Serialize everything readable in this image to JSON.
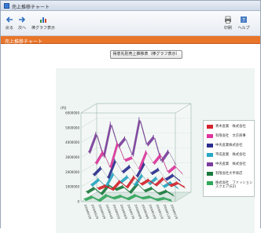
{
  "window": {
    "title": "売上推移チャート"
  },
  "toolbar": {
    "items": [
      {
        "label": "戻る",
        "icon": "back-arrow-icon"
      },
      {
        "label": "次へ",
        "icon": "forward-arrow-icon"
      },
      {
        "label": "棒グラフ表示",
        "icon": "bar-chart-icon"
      },
      {
        "label": "印刷",
        "icon": "printer-icon"
      },
      {
        "label": "ヘルプ",
        "icon": "help-icon"
      }
    ]
  },
  "tab": {
    "title": "売上推移チャート"
  },
  "report_button": {
    "label": "得意先別売上推移表（棒グラフ表示）"
  },
  "chart": {
    "ylabel": "(円)",
    "ytick_labels": [
      "6000000",
      "5000000",
      "4000000",
      "3000000",
      "2000000",
      "1000000",
      "0"
    ],
    "xtick_labels": [
      "2008年01月",
      "2008年02月",
      "2008年03月",
      "2008年04月",
      "2008年05月",
      "2008年06月",
      "2008年07月",
      "2008年08月",
      "2008年09月",
      "2008年10月",
      "2008年11月",
      "2008年12月",
      "2009年01月"
    ]
  },
  "chart_data": {
    "type": "line",
    "view": "3d",
    "ylim": [
      0,
      6000000
    ],
    "x": [
      "2008年01月",
      "2008年02月",
      "2008年03月",
      "2008年04月",
      "2008年05月",
      "2008年06月",
      "2008年07月",
      "2008年08月",
      "2008年09月",
      "2008年10月",
      "2008年11月",
      "2008年12月",
      "2009年01月"
    ],
    "series": [
      {
        "name": "青木産業　株式会社",
        "color": "#d6222b",
        "values": [
          400000,
          600000,
          350000,
          900000,
          500000,
          1200000,
          700000,
          1000000,
          650000,
          1100000,
          600000,
          800000,
          500000
        ]
      },
      {
        "name": "有限会社　文京商事",
        "color": "#e0339c",
        "values": [
          2200000,
          3000000,
          1900000,
          3600000,
          2400000,
          2600000,
          1800000,
          3000000,
          2200000,
          2800000,
          1600000,
          2000000,
          1500000
        ]
      },
      {
        "name": "中央産業株式会社",
        "color": "#2a2e8f",
        "values": [
          1500000,
          2000000,
          1300000,
          2500000,
          1700000,
          2100000,
          1400000,
          2300000,
          1600000,
          1900000,
          1200000,
          1500000,
          1100000
        ]
      },
      {
        "name": "平成産業　株式会社",
        "color": "#27a7c4",
        "values": [
          900000,
          1300000,
          800000,
          1700000,
          1100000,
          1500000,
          900000,
          1600000,
          1000000,
          1400000,
          800000,
          1100000,
          700000
        ]
      },
      {
        "name": "中央産業　株式会社",
        "color": "#7b3c9e",
        "values": [
          3200000,
          4500000,
          2900000,
          5200000,
          3600000,
          4200000,
          3000000,
          5500000,
          3700000,
          4300000,
          2600000,
          3300000,
          2400000
        ]
      },
      {
        "name": "有限会社大手商店",
        "color": "#1a7a3c",
        "values": [
          600000,
          900000,
          500000,
          1100000,
          800000,
          1000000,
          600000,
          1200000,
          700000,
          900000,
          500000,
          700000,
          400000
        ]
      },
      {
        "name": "株式会社　ファッションスクエア(EZ)",
        "color": "#2fa85a",
        "values": [
          200000,
          400000,
          150000,
          500000,
          300000,
          450000,
          250000,
          500000,
          300000,
          400000,
          200000,
          300000,
          150000
        ]
      }
    ]
  }
}
